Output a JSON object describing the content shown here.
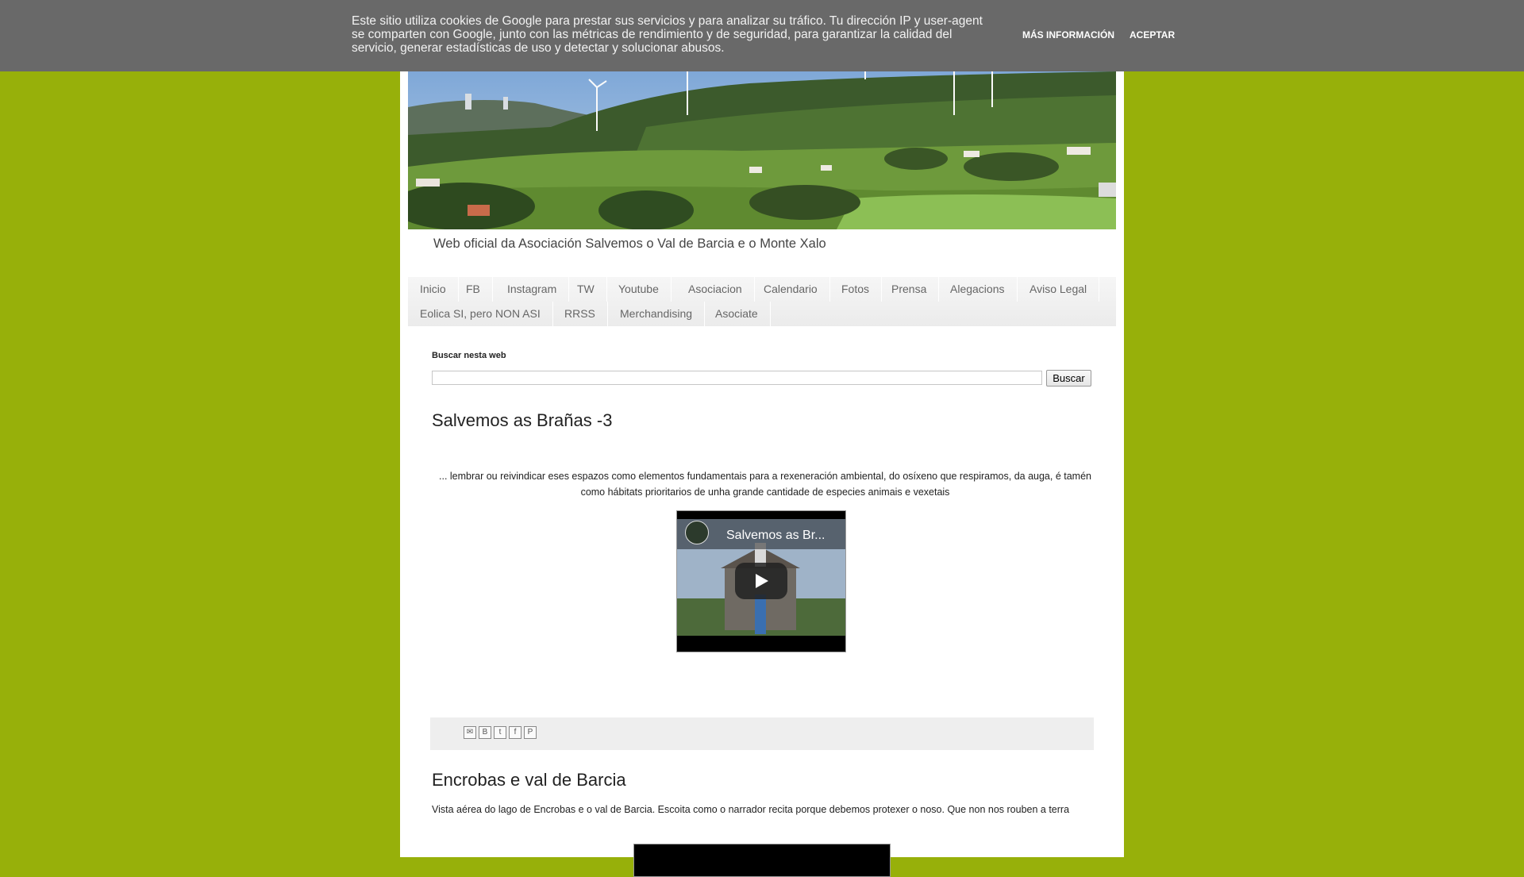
{
  "cookie": {
    "text": "Este sitio utiliza cookies de Google para prestar sus servicios y para analizar su tráfico. Tu dirección IP y user-agent se comparten con Google, junto con las métricas de rendimiento y de seguridad, para garantizar la calidad del servicio, generar estadísticas de uso y detectar y solucionar abusos.",
    "more_info": "MÁS INFORMACIÓN",
    "accept": "ACEPTAR"
  },
  "header": {
    "tagline": "Web oficial da Asociación Salvemos o Val de Barcia e o Monte Xalo"
  },
  "nav": {
    "row1": [
      "Inicio",
      "FB",
      "Instagram",
      "TW",
      "Youtube",
      "Asociacion",
      "Calendario",
      "Fotos",
      "Prensa",
      "Alegacions",
      "Aviso Legal"
    ],
    "row2": [
      "Eolica SI, pero NON ASI",
      "RRSS",
      "Merchandising",
      "Asociate"
    ]
  },
  "search": {
    "label": "Buscar nesta web",
    "value": "",
    "button": "Buscar"
  },
  "posts": [
    {
      "title": "Salvemos as Brañas -3",
      "body": "... lembrar ou reivindicar eses espazos como elementos fundamentais para a rexeneración ambiental, do osíxeno que respiramos, da auga, é tamén como hábitats prioritarios de unha grande cantidade de especies animais e vexetais",
      "video_title": "Salvemos as Br..."
    },
    {
      "title": "Encrobas e val de Barcia",
      "body": "Vista aérea do lago de Encrobas e o val de Barcia. Escoita como o narrador recita porque debemos protexer o noso. Que non nos rouben a terra"
    }
  ],
  "share_icons": [
    "email-icon",
    "blogger-icon",
    "twitter-icon",
    "facebook-icon",
    "pinterest-icon"
  ],
  "colors": {
    "background": "#97b00a",
    "cookie_bar": "#696969"
  }
}
